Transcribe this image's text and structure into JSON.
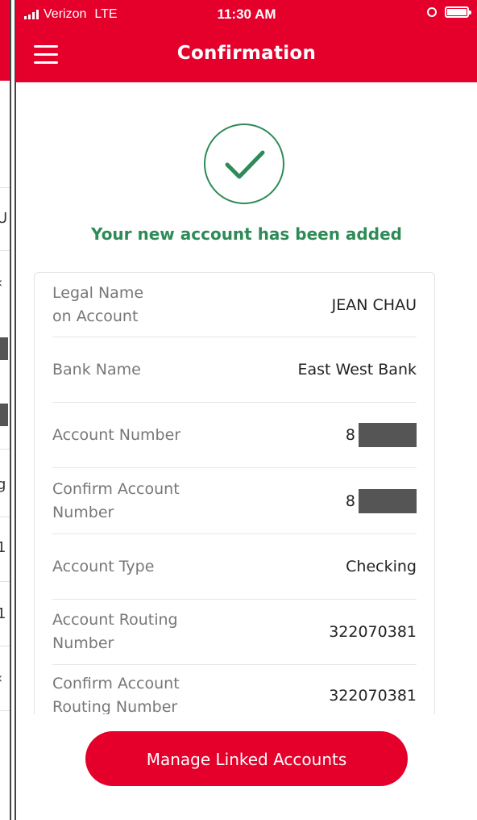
{
  "status_bar": {
    "carrier": "Verizon",
    "network": "LTE",
    "time": "11:30 AM"
  },
  "header": {
    "title": "Confirmation"
  },
  "success_message": "Your new account has been added",
  "details": [
    {
      "label": "Legal Name\non Account",
      "value": "JEAN CHAU"
    },
    {
      "label": "Bank Name",
      "value": "East West Bank"
    },
    {
      "label": "Account Number",
      "value": "8",
      "masked": true
    },
    {
      "label": "Confirm Account\nNumber",
      "value": "8",
      "masked": true
    },
    {
      "label": "Account Type",
      "value": "Checking"
    },
    {
      "label": "Account Routing\nNumber",
      "value": "322070381"
    },
    {
      "label": "Confirm Account\nRouting Number",
      "value": "322070381"
    }
  ],
  "actions": {
    "manage_label": "Manage Linked Accounts"
  },
  "colors": {
    "brand_red": "#e4002b",
    "success_green": "#2e8b57"
  },
  "icons": [
    "signal-icon",
    "lock-rotation-icon",
    "battery-icon",
    "hamburger-menu-icon",
    "checkmark-circle-icon"
  ]
}
